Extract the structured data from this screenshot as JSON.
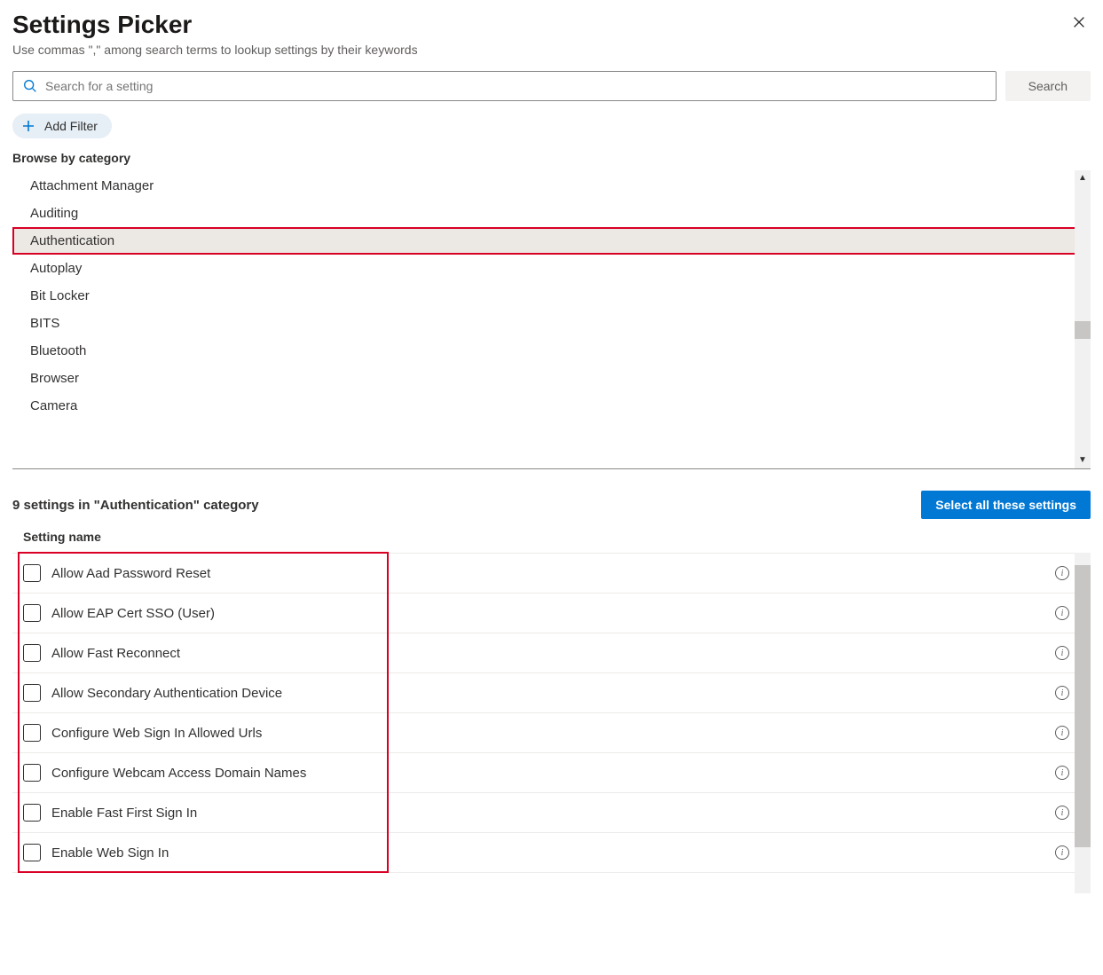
{
  "header": {
    "title": "Settings Picker",
    "subtitle": "Use commas \",\" among search terms to lookup settings by their keywords"
  },
  "search": {
    "placeholder": "Search for a setting",
    "button_label": "Search"
  },
  "filter": {
    "add_label": "Add Filter"
  },
  "browse_label": "Browse by category",
  "categories": [
    "Attachment Manager",
    "Auditing",
    "Authentication",
    "Autoplay",
    "Bit Locker",
    "BITS",
    "Bluetooth",
    "Browser",
    "Camera"
  ],
  "selected_category_index": 2,
  "results": {
    "summary": "9 settings in \"Authentication\" category",
    "select_all_label": "Select all these settings",
    "column_header": "Setting name"
  },
  "settings": [
    "Allow Aad Password Reset",
    "Allow EAP Cert SSO (User)",
    "Allow Fast Reconnect",
    "Allow Secondary Authentication Device",
    "Configure Web Sign In Allowed Urls",
    "Configure Webcam Access Domain Names",
    "Enable Fast First Sign In",
    "Enable Web Sign In"
  ],
  "colors": {
    "primary": "#0078d4",
    "highlight": "#d80024"
  }
}
